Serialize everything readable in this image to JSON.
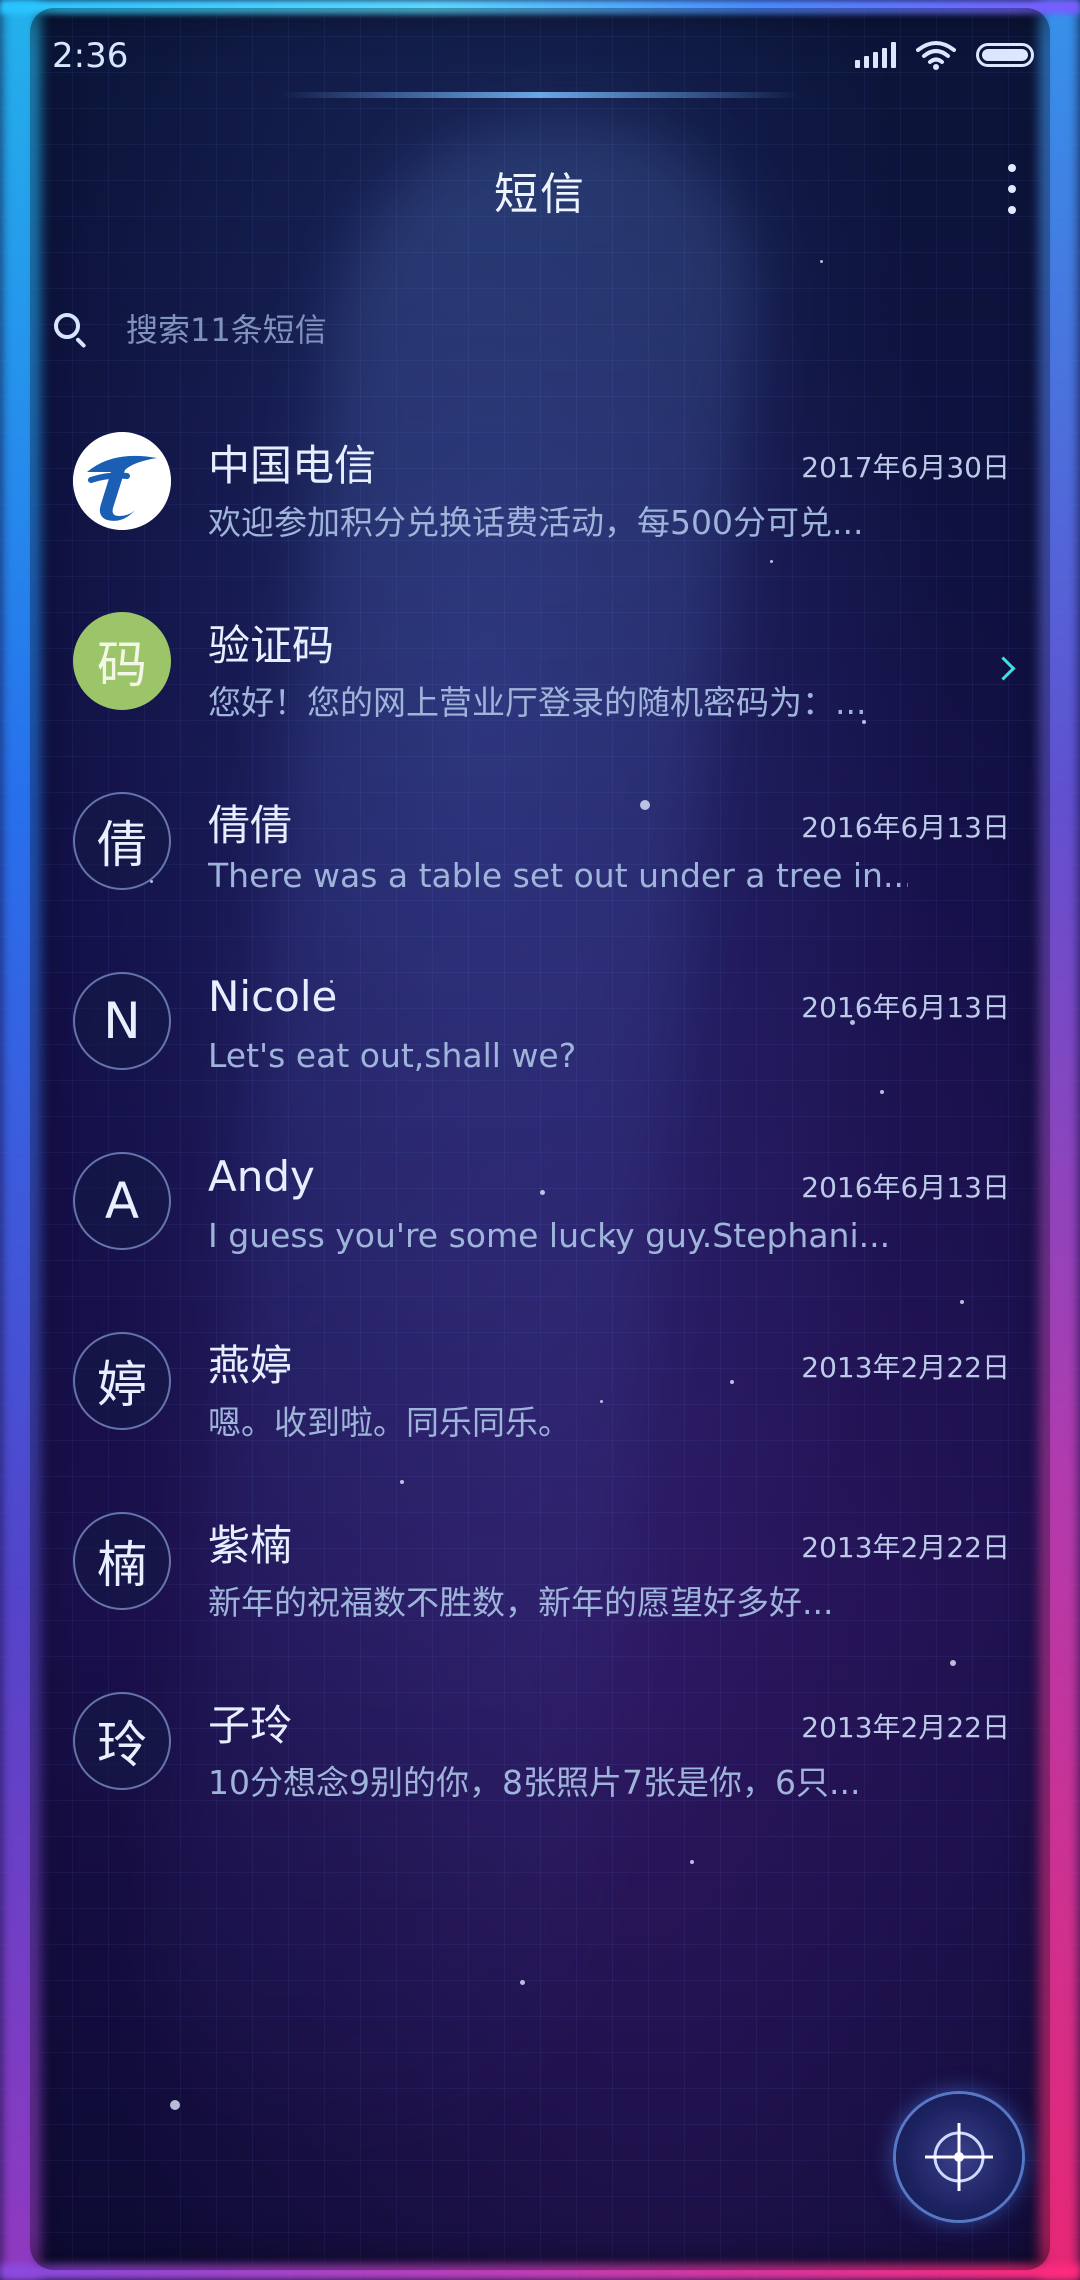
{
  "status_bar": {
    "time": "2:36"
  },
  "header": {
    "title": "短信"
  },
  "search": {
    "placeholder": "搜索11条短信"
  },
  "threads": [
    {
      "avatar_text": "",
      "avatar_style": "logo",
      "name": "中国电信",
      "date": "2017年6月30日",
      "preview": "欢迎参加积分兑换话费活动，每500分可兑..."
    },
    {
      "avatar_text": "码",
      "avatar_style": "green",
      "name": "验证码",
      "date": "",
      "preview": "您好！您的网上营业厅登录的随机密码为：..."
    },
    {
      "avatar_text": "倩",
      "avatar_style": "outline",
      "name": "倩倩",
      "date": "2016年6月13日",
      "preview": "There was a table set out under a tree in..."
    },
    {
      "avatar_text": "N",
      "avatar_style": "outline",
      "name": "Nicole",
      "date": "2016年6月13日",
      "preview": "Let's eat out,shall we?"
    },
    {
      "avatar_text": "A",
      "avatar_style": "outline",
      "name": "Andy",
      "date": "2016年6月13日",
      "preview": "I guess you're some lucky guy.Stephani..."
    },
    {
      "avatar_text": "婷",
      "avatar_style": "outline",
      "name": "燕婷",
      "date": "2013年2月22日",
      "preview": "嗯。收到啦。同乐同乐。"
    },
    {
      "avatar_text": "楠",
      "avatar_style": "outline",
      "name": "紫楠",
      "date": "2013年2月22日",
      "preview": "新年的祝福数不胜数，新年的愿望好多好..."
    },
    {
      "avatar_text": "玲",
      "avatar_style": "outline",
      "name": "子玲",
      "date": "2013年2月22日",
      "preview": "10分想念9别的你，8张照片7张是你，6只..."
    }
  ],
  "icons": {
    "search": "search-icon",
    "more": "more-vertical-icon",
    "compose": "compose-crosshair-icon",
    "operator_logo": "china-telecom-logo"
  },
  "colors": {
    "accent_cyan": "#27c3ff",
    "accent_pink": "#ff2a7a",
    "verification_avatar": "#9cc56a"
  }
}
